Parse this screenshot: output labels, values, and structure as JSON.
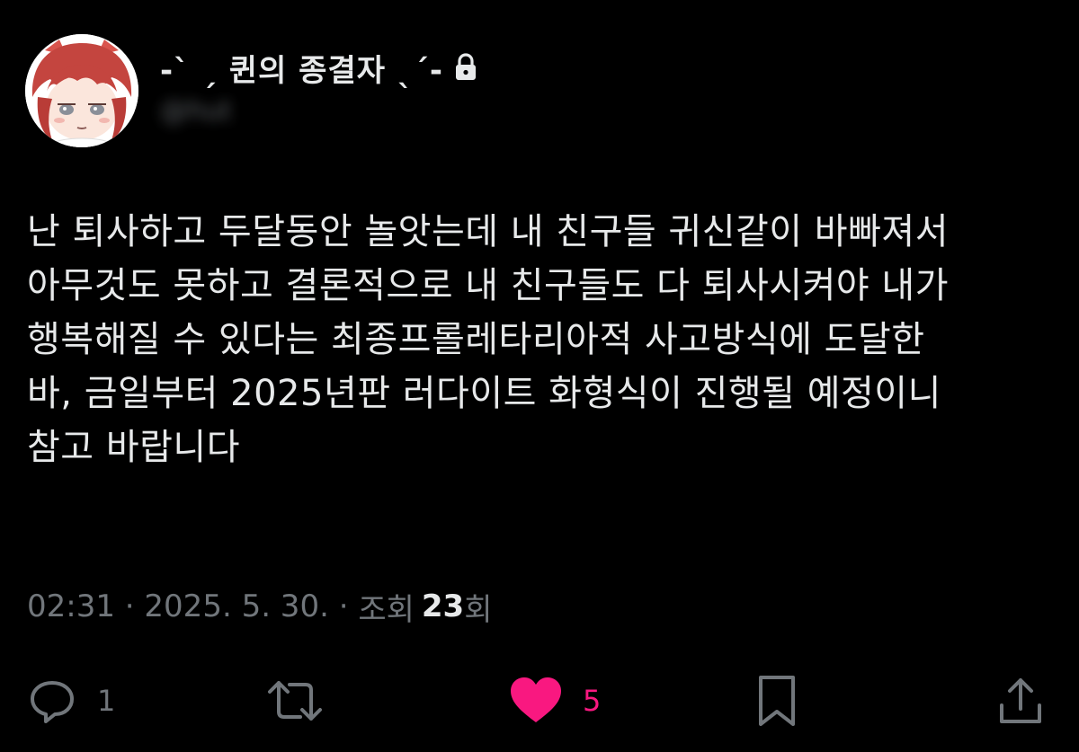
{
  "author": {
    "display_name": "-ˋ ˏ 퀸의 종결자 ˎˊ-",
    "handle": "@hut",
    "avatar_icon": "avatar-icon",
    "protected_icon": "lock-icon"
  },
  "tweet": {
    "text": "난 퇴사하고 두달동안 놀앗는데 내 친구들 귀신같이 바빠져서\n아무것도 못하고 결론적으로 내 친구들도 다 퇴사시켜야 내가\n행복해질 수 있다는 최종프롤레타리아적 사고방식에 도달한\n바, 금일부터 2025년판 러다이트 화형식이 진행될 예정이니\n참고 바랍니다"
  },
  "meta": {
    "time": "02:31",
    "separator1": " · ",
    "date": "2025. 5. 30.",
    "separator2": " · ",
    "views_label": "조회",
    "views_count": "23",
    "views_suffix": "회"
  },
  "actions": {
    "reply": {
      "icon": "reply-icon",
      "count": "1"
    },
    "retweet": {
      "icon": "retweet-icon",
      "count": ""
    },
    "like": {
      "icon": "heart-icon",
      "count": "5",
      "active": true
    },
    "bookmark": {
      "icon": "bookmark-icon",
      "count": ""
    },
    "share": {
      "icon": "share-icon",
      "count": ""
    }
  },
  "colors": {
    "background": "#000000",
    "text_primary": "#e7e9ea",
    "text_secondary": "#71767b",
    "like_active": "#f91880",
    "avatar_hair": "#c4453f"
  }
}
